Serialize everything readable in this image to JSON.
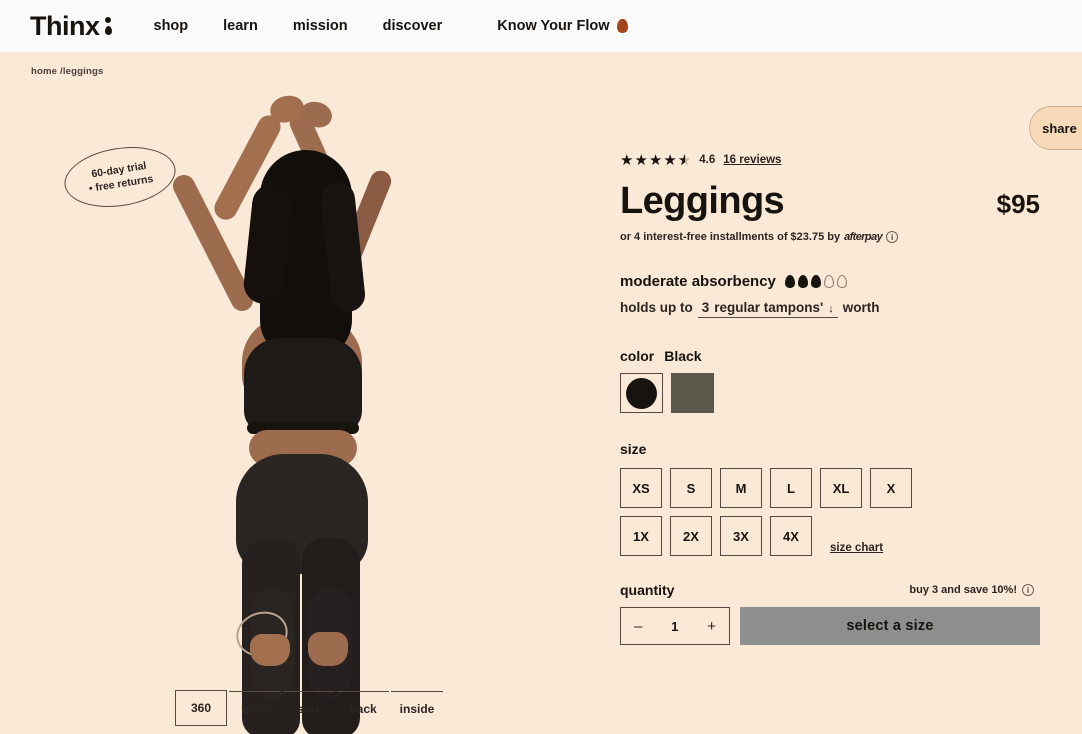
{
  "header": {
    "logo": "Thinx",
    "nav": [
      {
        "label": "shop"
      },
      {
        "label": "learn"
      },
      {
        "label": "mission"
      },
      {
        "label": "discover"
      },
      {
        "label": "Know Your Flow"
      }
    ]
  },
  "breadcrumb": "home /leggings",
  "share": {
    "label": "share"
  },
  "badge": {
    "line1": "60-day trial",
    "line2": "• free returns"
  },
  "gallery": {
    "views": [
      {
        "label": "360",
        "selected": true
      },
      {
        "label": "front",
        "selected": false
      },
      {
        "label": "side",
        "selected": false
      },
      {
        "label": "back",
        "selected": false
      },
      {
        "label": "inside",
        "selected": false
      }
    ]
  },
  "product": {
    "rating_value": "4.6",
    "stars_filled": 4,
    "stars_half": 1,
    "reviews_link": "16 reviews",
    "title": "Leggings",
    "price": "$95",
    "installments_pre": "or 4 interest-free installments of $23.75 by",
    "installments_brand": "afterpay",
    "absorbency_label": "moderate absorbency",
    "drops_filled": 3,
    "drops_empty": 2,
    "holds_pre": "holds up to",
    "holds_count": "3",
    "holds_unit": "regular tampons'",
    "holds_post": "worth",
    "color_label": "color",
    "color_name": "Black",
    "swatches": [
      {
        "name": "Black",
        "hex": "#17130F",
        "selected": true
      },
      {
        "name": "Olive",
        "hex": "#5B584B",
        "selected": false
      }
    ],
    "size_label": "size",
    "sizes_row1": [
      "XS",
      "S",
      "M",
      "L",
      "XL",
      "X"
    ],
    "sizes_row2": [
      "1X",
      "2X",
      "3X",
      "4X"
    ],
    "size_chart_link": "size chart",
    "quantity_label": "quantity",
    "promo_text": "buy 3 and save 10%!",
    "quantity_value": "1",
    "qty_minus": "–",
    "qty_plus": "+",
    "add_to_cart_label": "select a size"
  },
  "colors": {
    "page_bg": "#FBE9D7",
    "header_bg": "#FBFAFB",
    "ink": "#17130F",
    "accent": "#A8441E",
    "cta_bg": "#8E8E8E",
    "share_bg": "#F8D9B8"
  }
}
